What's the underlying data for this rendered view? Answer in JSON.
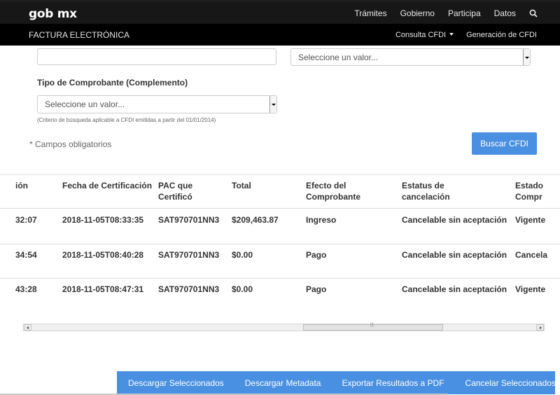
{
  "topbar": {
    "logo": "gob mx",
    "nav": [
      "Trámites",
      "Gobierno",
      "Participa",
      "Datos"
    ]
  },
  "subbar": {
    "title": "FACTURA ELECTRÓNICA",
    "nav": [
      "Consulta CFDI",
      "Generación de CFDI"
    ]
  },
  "form": {
    "select_top_value": "Seleccione un valor...",
    "tipo_label": "Tipo de Comprobante (Complemento)",
    "tipo_select_value": "Seleccione un valor...",
    "hint": "(Criterio de búsqueda aplicable a CFDI emitidas a partir del 01/01/2014)",
    "required_note": "* Campos obligatorios",
    "search_button": "Buscar CFDI"
  },
  "table": {
    "headers": [
      "ión",
      "Fecha de Certificación",
      "PAC que Certificó",
      "Total",
      "Efecto del Comprobante",
      "Estatus de cancelación",
      "Estado Compr"
    ],
    "rows": [
      [
        "32:07",
        "2018-11-05T08:33:35",
        "SAT970701NN3",
        "$209,463.87",
        "Ingreso",
        "Cancelable sin aceptación",
        "Vigente"
      ],
      [
        "34:54",
        "2018-11-05T08:40:28",
        "SAT970701NN3",
        "$0.00",
        "Pago",
        "Cancelable sin aceptación",
        "Cancela"
      ],
      [
        "43:28",
        "2018-11-05T08:47:31",
        "SAT970701NN3",
        "$0.00",
        "Pago",
        "Cancelable sin aceptación",
        "Vigente"
      ]
    ]
  },
  "actions": [
    "Descargar Seleccionados",
    "Descargar Metadata",
    "Exportar Resultados a PDF",
    "Cancelar Seleccionados"
  ],
  "colors": {
    "accent": "#4a90e2",
    "topbar": "#171717",
    "subbar": "#000000"
  },
  "icons": {
    "search": "search-icon",
    "dropdown": "chevron-down-icon"
  }
}
